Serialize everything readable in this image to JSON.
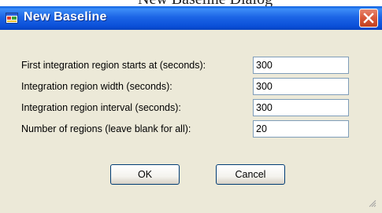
{
  "partial_text": "New Baseline Dialog",
  "window": {
    "title": "New Baseline"
  },
  "fields": [
    {
      "label": "First integration region starts at (seconds):",
      "value": "300"
    },
    {
      "label": "Integration region width (seconds):",
      "value": "300"
    },
    {
      "label": "Integration region interval (seconds):",
      "value": "300"
    },
    {
      "label": "Number of regions (leave blank for all):",
      "value": "20"
    }
  ],
  "buttons": {
    "ok": "OK",
    "cancel": "Cancel"
  },
  "icons": {
    "app": "app-window-icon",
    "close": "close-icon",
    "resize": "resize-grip-icon"
  },
  "colors": {
    "titlebar": "#0a4fd8",
    "close": "#d8583a",
    "face": "#ece9d8"
  }
}
